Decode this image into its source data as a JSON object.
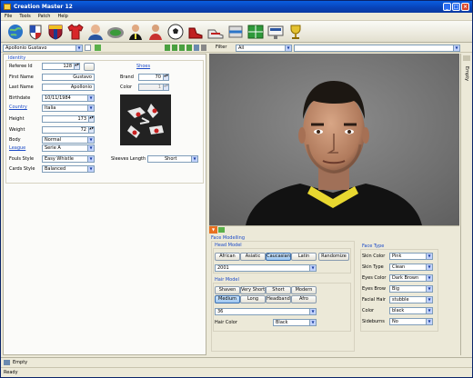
{
  "window": {
    "title": "Creation Master 12"
  },
  "menu": [
    "File",
    "Tools",
    "Patch",
    "Help"
  ],
  "toolbar_icons": [
    "globe-icon",
    "country-icon",
    "club-icon",
    "shirt-icon",
    "player-icon",
    "stadium-icon",
    "referee-icon",
    "trainer-icon",
    "ball-icon",
    "boot-icon",
    "shoe-icon",
    "kit-icon",
    "field-icon",
    "scoreboard-icon",
    "trophy-icon"
  ],
  "selector": {
    "player": "Apollonio Gustavo",
    "filter_label": "Filter",
    "filter_value": "All"
  },
  "identity": {
    "section": "Identity",
    "referee_id_label": "Referee Id",
    "referee_id": "128",
    "first_name_label": "First Name",
    "first_name": "Gustavo",
    "last_name_label": "Last Name",
    "last_name": "Apollonio",
    "birthdate_label": "Birthdate",
    "birthdate": "10/11/1984",
    "country_label": "Country",
    "country": "Italia",
    "height_label": "Height",
    "height": "173",
    "weight_label": "Weight",
    "weight": "72",
    "body_label": "Body",
    "body": "Normal",
    "league_label": "League",
    "league": "Serie A",
    "fouls_label": "Fouls Style",
    "fouls": "Easy Whistle",
    "cards_label": "Cards Style",
    "cards": "Balanced",
    "shoes_label": "Shoes",
    "brand_label": "Brand",
    "brand": "70",
    "color_label": "Color",
    "color": "1",
    "sleeves_label": "Sleeves Length",
    "sleeves": "Short"
  },
  "face": {
    "section": "Face Modelling",
    "head_model_label": "Head Model",
    "ethnic_buttons": [
      "African",
      "Asiatic",
      "Caucasian",
      "Latin"
    ],
    "ethnic_selected": "Caucasian",
    "randomize": "Randomize",
    "head_model": "2001",
    "hair_model_label": "Hair Model",
    "hair_buttons": [
      "Shaven",
      "Very Short",
      "Short",
      "Modern",
      "Medium",
      "Long",
      "Headband",
      "Afro"
    ],
    "hair_selected": "Medium",
    "hair_model": "36",
    "hair_color_label": "Hair Color",
    "hair_color": "Black",
    "face_type_label": "Face Type",
    "skin_color_label": "Skin Color",
    "skin_color": "Pink",
    "skin_type_label": "Skin Type",
    "skin_type": "Clean",
    "eyes_color_label": "Eyes Color",
    "eyes_color": "Dark Brown",
    "eyes_brow_label": "Eyes Brow",
    "eyes_brow": "Big",
    "facial_hair_label": "Facial Hair",
    "facial_hair": "stubble",
    "color_label": "Color",
    "color": "black",
    "sideburns_label": "Sideburns",
    "sideburns": "No"
  },
  "sidebar": {
    "label": "Empty"
  },
  "bottom": {
    "label": "Empty"
  },
  "status": "Ready"
}
